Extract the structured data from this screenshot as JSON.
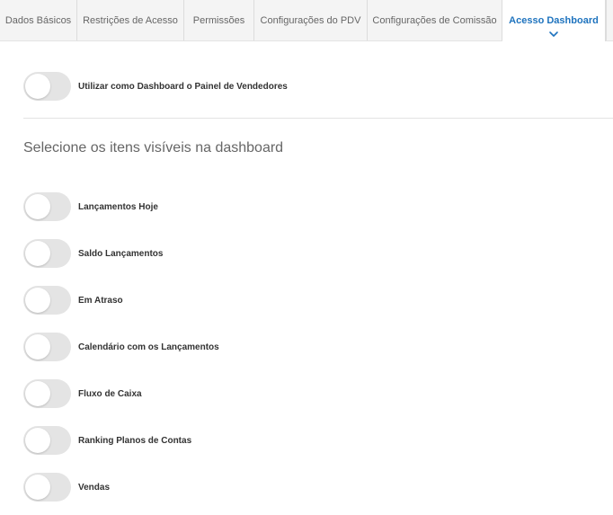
{
  "tabs": [
    {
      "label": "Dados Básicos",
      "active": false
    },
    {
      "label": "Restrições de Acesso",
      "active": false
    },
    {
      "label": "Permissões",
      "active": false
    },
    {
      "label": "Configurações do PDV",
      "active": false
    },
    {
      "label": "Configurações de Comissão",
      "active": false
    },
    {
      "label": "Acesso Dashboard",
      "active": true
    }
  ],
  "main_toggle": {
    "label": "Utilizar como Dashboard o Painel de Vendedores",
    "checked": false
  },
  "section_title": "Selecione os itens visíveis na dashboard",
  "items": [
    {
      "label": "Lançamentos Hoje",
      "checked": false
    },
    {
      "label": "Saldo Lançamentos",
      "checked": false
    },
    {
      "label": "Em Atraso",
      "checked": false
    },
    {
      "label": "Calendário com os Lançamentos",
      "checked": false
    },
    {
      "label": "Fluxo de Caixa",
      "checked": false
    },
    {
      "label": "Ranking Planos de Contas",
      "checked": false
    },
    {
      "label": "Vendas",
      "checked": false
    }
  ],
  "colors": {
    "accent": "#1e73be",
    "toggle_off": "#e4e4e4",
    "tab_bar": "#f4f4f4"
  },
  "icons": {
    "active_tab_indicator": "chevron-down-icon"
  }
}
